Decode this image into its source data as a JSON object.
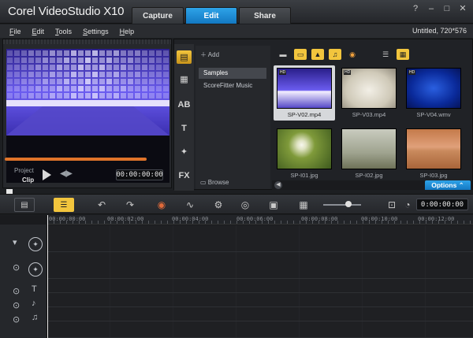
{
  "app": {
    "title": "Corel VideoStudio X10"
  },
  "tabs": [
    {
      "label": "Capture"
    },
    {
      "label": "Edit"
    },
    {
      "label": "Share"
    }
  ],
  "menu": {
    "items": [
      "File",
      "Edit",
      "Tools",
      "Settings",
      "Help"
    ],
    "project_info": "Untitled, 720*576"
  },
  "preview": {
    "mode_project": "Project",
    "mode_clip": "Clip",
    "timecode": "00:00:00:00"
  },
  "library": {
    "add_label": "Add",
    "browse_label": "Browse",
    "folders": [
      "Samples",
      "ScoreFitter Music"
    ],
    "thumbnails": [
      {
        "caption": "SP-V02.mp4"
      },
      {
        "caption": "SP-V03.mp4"
      },
      {
        "caption": "SP-V04.wmv"
      },
      {
        "caption": "SP-I01.jpg"
      },
      {
        "caption": "SP-I02.jpg"
      },
      {
        "caption": "SP-I03.jpg"
      }
    ],
    "options_label": "Options"
  },
  "timeline": {
    "timecode": "0:00:00:00",
    "ruler": [
      "00:00:00:00",
      "00:00:02:00",
      "00:00:04:00",
      "00:00:06:00",
      "00:00:08:00",
      "00:00:10:00",
      "00:00:12:00"
    ]
  },
  "colors": {
    "accent_blue": "#1e8fd9",
    "accent_yellow": "#f2c53d",
    "scrubber_orange": "#e0742a"
  }
}
